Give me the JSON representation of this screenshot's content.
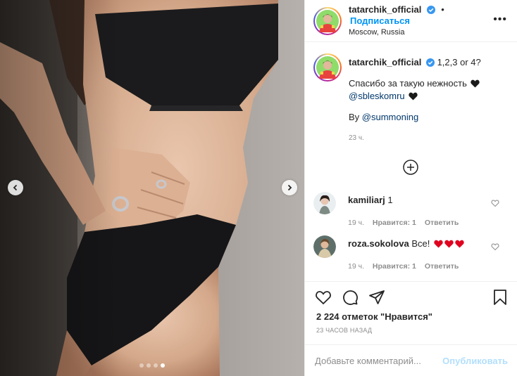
{
  "post": {
    "username": "tatarchik_official",
    "location": "Moscow, Russia",
    "follow_label": "Подписаться",
    "bullet": "•",
    "more": "•••",
    "slides_total": 4,
    "slide_active": 4
  },
  "caption": {
    "username": "tatarchik_official",
    "text": "1,2,3 or 4?",
    "line2": "Спасибо за такую нежность",
    "line3_mention": "@sbleskomru",
    "line4_prefix": "By ",
    "line4_mention": "@summoning",
    "time": "23 ч."
  },
  "comments": [
    {
      "username": "kamiliarj",
      "text": "1",
      "time": "19 ч.",
      "likes": "Нравится: 1",
      "reply": "Ответить"
    },
    {
      "username": "roza.sokolova",
      "text": "Все!",
      "time": "19 ч.",
      "likes": "Нравится: 1",
      "reply": "Ответить"
    }
  ],
  "stats": {
    "likes": "2 224 отметок \"Нравится\"",
    "time": "23 ЧАСОВ НАЗАД"
  },
  "compose": {
    "placeholder": "Добавьте комментарий...",
    "publish": "Опубликовать"
  },
  "colors": {
    "link": "#0095f6",
    "mention": "#00376b",
    "muted": "#8e8e8e",
    "heart": "#e0001f"
  }
}
